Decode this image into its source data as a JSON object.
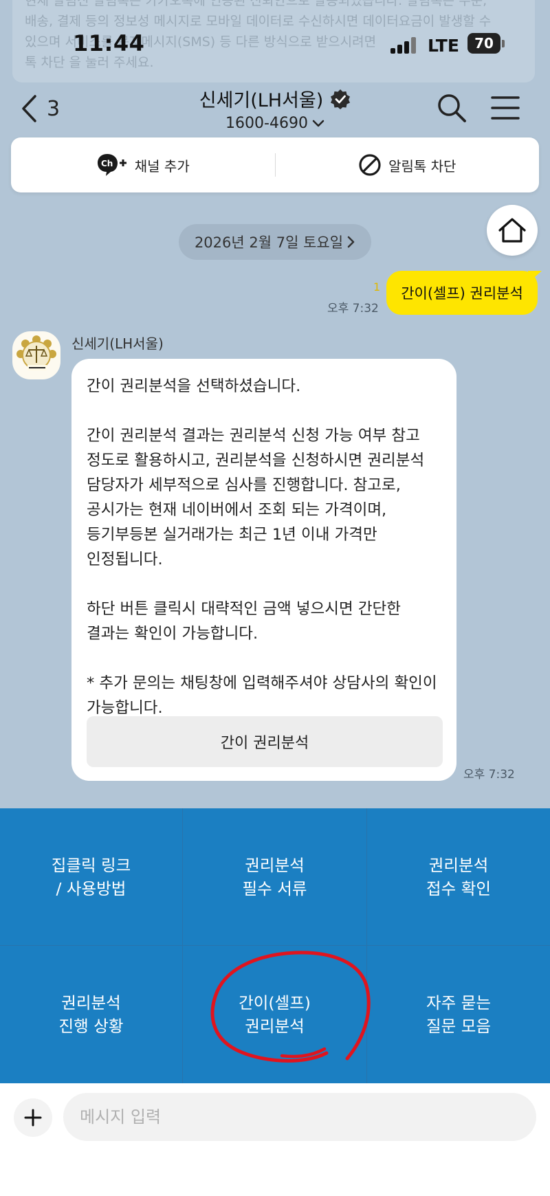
{
  "background_notice": {
    "lines": [
      "현재 알림신 알림톡은 카카오톡에 인증된 신뢰안으로 발송되었습니다. 알림톡은 주문,",
      "배송, 결제 등의 정보성 메시지로 모바일 데이터로 수신하시면 데이터요금이 발생할 수",
      "있으며 서비스를 문자메시지(SMS) 등 다른 방식으로 받으시려면",
      "톡 차단 을 눌러 주세요."
    ]
  },
  "status_bar": {
    "time": "11:44",
    "network": "LTE",
    "battery": "70"
  },
  "header": {
    "back_count": "3",
    "channel_name": "신세기(LH서울)",
    "phone": "1600-4690"
  },
  "action_bar": {
    "add_channel": "채널 추가",
    "block_alert": "알림톡 차단"
  },
  "date_divider": "2026년 2월 7일 토요일",
  "my_message": {
    "text": "간이(셀프) 권리분석",
    "unread": "1",
    "time": "오후 7:32"
  },
  "bot_message": {
    "sender": "신세기(LH서울)",
    "paragraphs": [
      "간이 권리분석을 선택하셨습니다.",
      "간이 권리분석 결과는 권리분석 신청 가능 여부 참고 정도로 활용하시고, 권리분석을 신청하시면 권리분석 담당자가 세부적으로 심사를 진행합니다. 참고로, 공시가는 현재 네이버에서 조회 되는 가격이며, 등기부등본 실거래가는 최근 1년 이내 가격만 인정됩니다.",
      "하단 버튼 클릭시 대략적인 금액 넣으시면 간단한 결과는 확인이 가능합니다.",
      "* 추가 문의는 채팅창에 입력해주셔야 상담사의 확인이 가능합니다."
    ],
    "button_label": "간이 권리분석",
    "time": "오후 7:32"
  },
  "menu": [
    {
      "label": "집클릭 링크\n/ 사용방법"
    },
    {
      "label": "권리분석\n필수 서류"
    },
    {
      "label": "권리분석\n접수 확인"
    },
    {
      "label": "권리분석\n진행 상황"
    },
    {
      "label": "간이(셀프)\n권리분석"
    },
    {
      "label": "자주 묻는\n질문 모음"
    }
  ],
  "input": {
    "placeholder": "메시지 입력"
  },
  "colors": {
    "chat_bg": "#b2c5d6",
    "my_bubble": "#fee500",
    "menu_bg": "#1b7fc2",
    "annotation": "#e0141e"
  },
  "icons": [
    "back-chevron-icon",
    "verified-badge-icon",
    "chevron-down-icon",
    "search-icon",
    "menu-icon",
    "channel-add-icon",
    "block-icon",
    "home-icon",
    "chevron-right-icon",
    "plus-icon"
  ]
}
